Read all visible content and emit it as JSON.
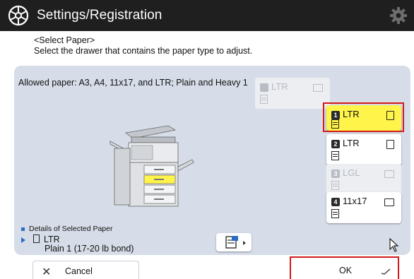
{
  "header": {
    "title": "Settings/Registration",
    "icons": [
      "settings-wheel-icon",
      "gear-icon"
    ]
  },
  "instructions": {
    "line1": "<Select Paper>",
    "line2": "Select the drawer that contains the paper type to adjust."
  },
  "allowed_paper": "Allowed paper: A3, A4, 11x17, and LTR; Plain and Heavy 1",
  "drawers": [
    {
      "id": "bypass",
      "num": "",
      "size": "LTR",
      "state": "disabled",
      "orientation": "landscape",
      "icon": "bypass-tray-icon"
    },
    {
      "id": "1",
      "num": "1",
      "size": "LTR",
      "state": "selected",
      "orientation": "portrait"
    },
    {
      "id": "2",
      "num": "2",
      "size": "LTR",
      "state": "enabled",
      "orientation": "portrait"
    },
    {
      "id": "3",
      "num": "3",
      "size": "LGL",
      "state": "disabled",
      "orientation": "landscape"
    },
    {
      "id": "4",
      "num": "4",
      "size": "11x17",
      "state": "enabled",
      "orientation": "landscape"
    }
  ],
  "details": {
    "heading": "Details of Selected Paper",
    "size": "LTR",
    "type": "Plain 1 (17-20 lb bond)"
  },
  "buttons": {
    "cancel": "Cancel",
    "ok": "OK"
  },
  "colors": {
    "titlebar": "#1f1f1f",
    "panel": "#d6dde8",
    "selected_drawer": "#fff44a",
    "highlight_outline": "#d51919",
    "accent": "#2b6cc4"
  }
}
